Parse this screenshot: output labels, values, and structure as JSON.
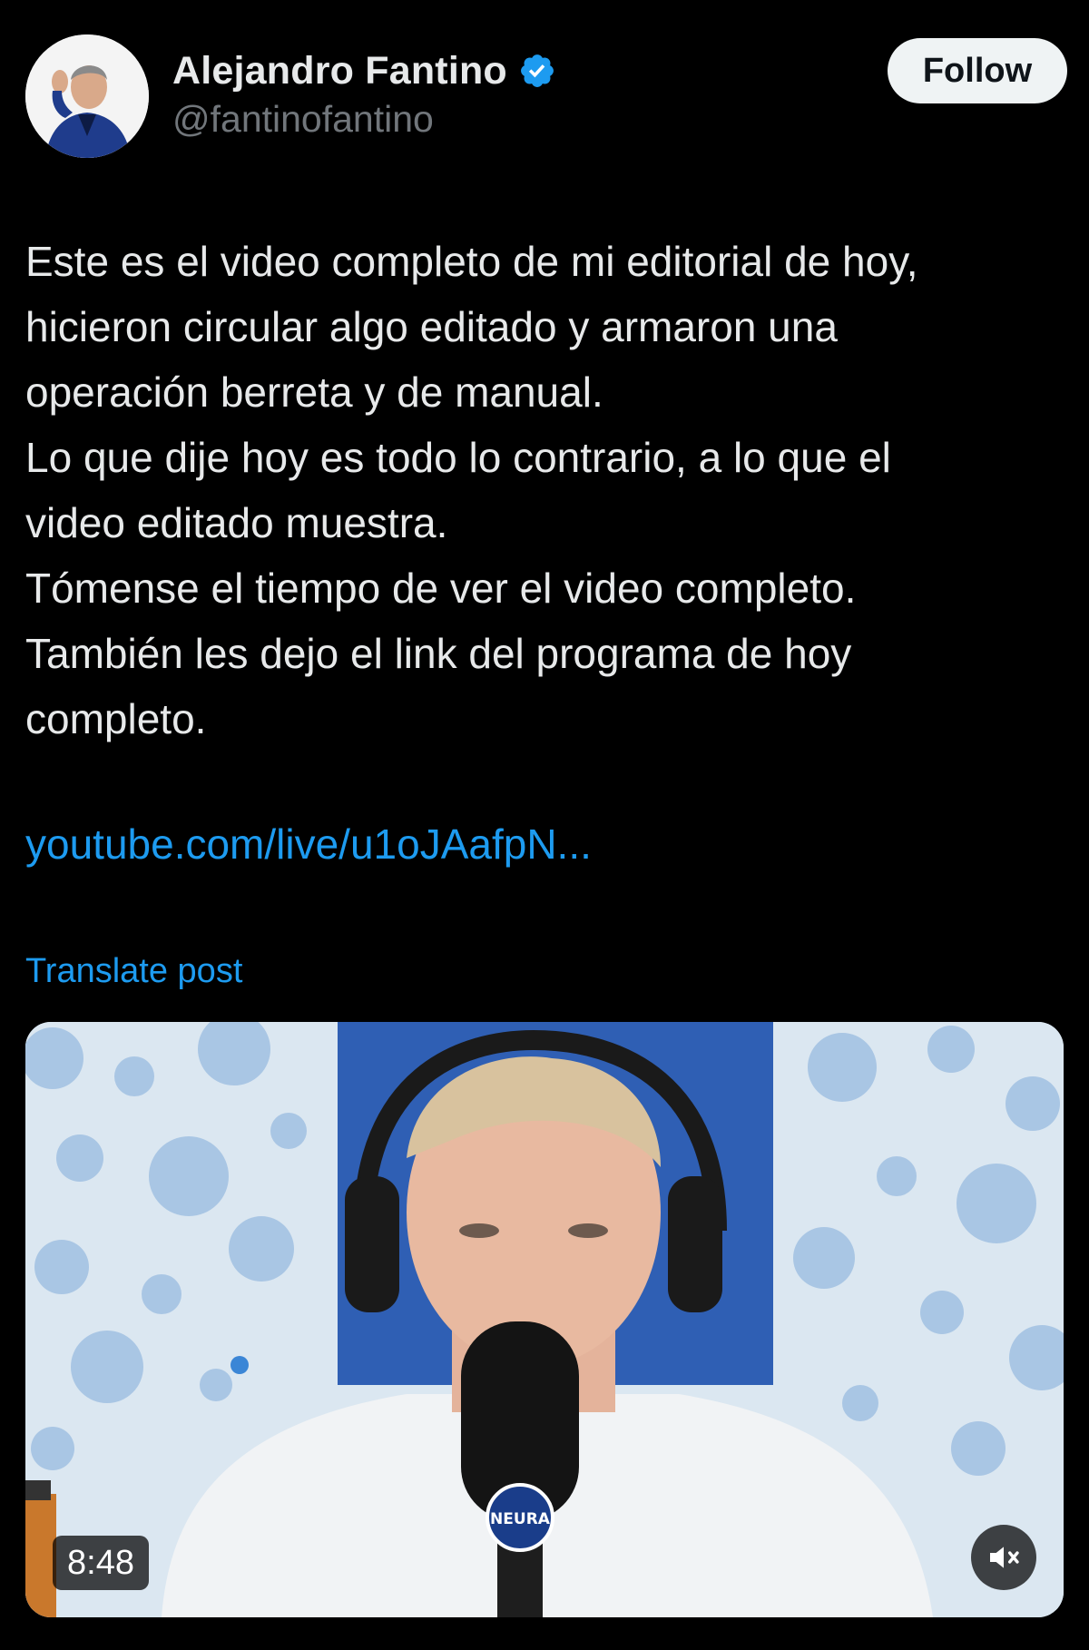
{
  "author": {
    "display_name": "Alejandro Fantino",
    "handle": "@fantinofantino",
    "verified": true,
    "avatar_icon": "profile-photo"
  },
  "follow_button": {
    "label": "Follow"
  },
  "post": {
    "lines": [
      "Este es el video completo de mi editorial de hoy,",
      "hicieron circular algo editado y armaron una",
      "operación berreta y de manual.",
      "Lo que dije hoy es todo lo contrario, a lo que el",
      "video editado muestra.",
      "Tómense el tiempo de ver el video completo.",
      "También les dejo el link del programa de hoy",
      "completo."
    ],
    "link_text": "youtube.com/live/u1oJAafpN...",
    "translate_label": "Translate post"
  },
  "media": {
    "type": "video",
    "duration": "8:48",
    "muted": true,
    "mic_brand": "NEURA",
    "mute_icon": "speaker-muted-icon"
  },
  "colors": {
    "background": "#000000",
    "text_primary": "#e7e9ea",
    "text_secondary": "#71767b",
    "link": "#1d9bf0",
    "verified": "#1d9bf0",
    "follow_bg": "#eff3f4"
  }
}
